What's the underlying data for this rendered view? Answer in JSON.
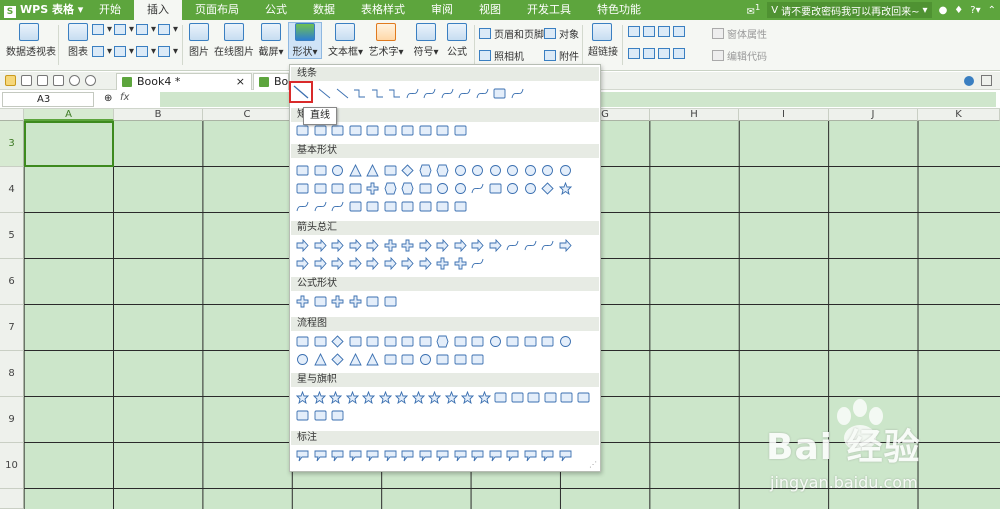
{
  "window": {
    "app_name": "WPS 表格",
    "menu_tabs": [
      "开始",
      "插入",
      "页面布局",
      "公式",
      "数据",
      "表格样式",
      "审阅",
      "视图",
      "开发工具",
      "特色功能"
    ],
    "active_tab": "插入",
    "message": "请不要改密码我可以再改回来~",
    "notify_count": "1",
    "help_symbol": "?"
  },
  "ribbon": {
    "pivot_table": "数据透视表",
    "chart": "图表",
    "picture": "图片",
    "online_picture": "在线图片",
    "screenshot": "截屏",
    "shapes": "形状",
    "textbox": "文本框",
    "art_text": "艺术字",
    "symbol": "符号",
    "formula": "公式",
    "header_footer": "页眉和页脚",
    "object": "对象",
    "camera": "照相机",
    "attachment": "附件",
    "hyperlink": "超链接",
    "form_properties": "窗体属性",
    "edit_code": "编辑代码"
  },
  "document_tabs": [
    {
      "name": "Book4 *",
      "close": "×"
    },
    {
      "name": "Boo"
    }
  ],
  "formula_bar": {
    "cell_ref": "A3",
    "fx": "fx"
  },
  "sheet": {
    "columns": [
      "A",
      "B",
      "C",
      "D",
      "E",
      "F",
      "G",
      "H",
      "I",
      "J",
      "K"
    ],
    "rows": [
      "3",
      "4",
      "5",
      "6",
      "7",
      "8",
      "9",
      "10"
    ],
    "selected_column": "A",
    "selected_row": "3"
  },
  "shapes_panel": {
    "sections": [
      "线条",
      "矩形",
      "基本形状",
      "箭头总汇",
      "公式形状",
      "流程图",
      "星与旗帜",
      "标注"
    ],
    "tooltip": "直线",
    "selected_shape": "直线"
  },
  "watermark": {
    "main": "Bai 经验",
    "sub": "jingyan.baidu.com"
  }
}
